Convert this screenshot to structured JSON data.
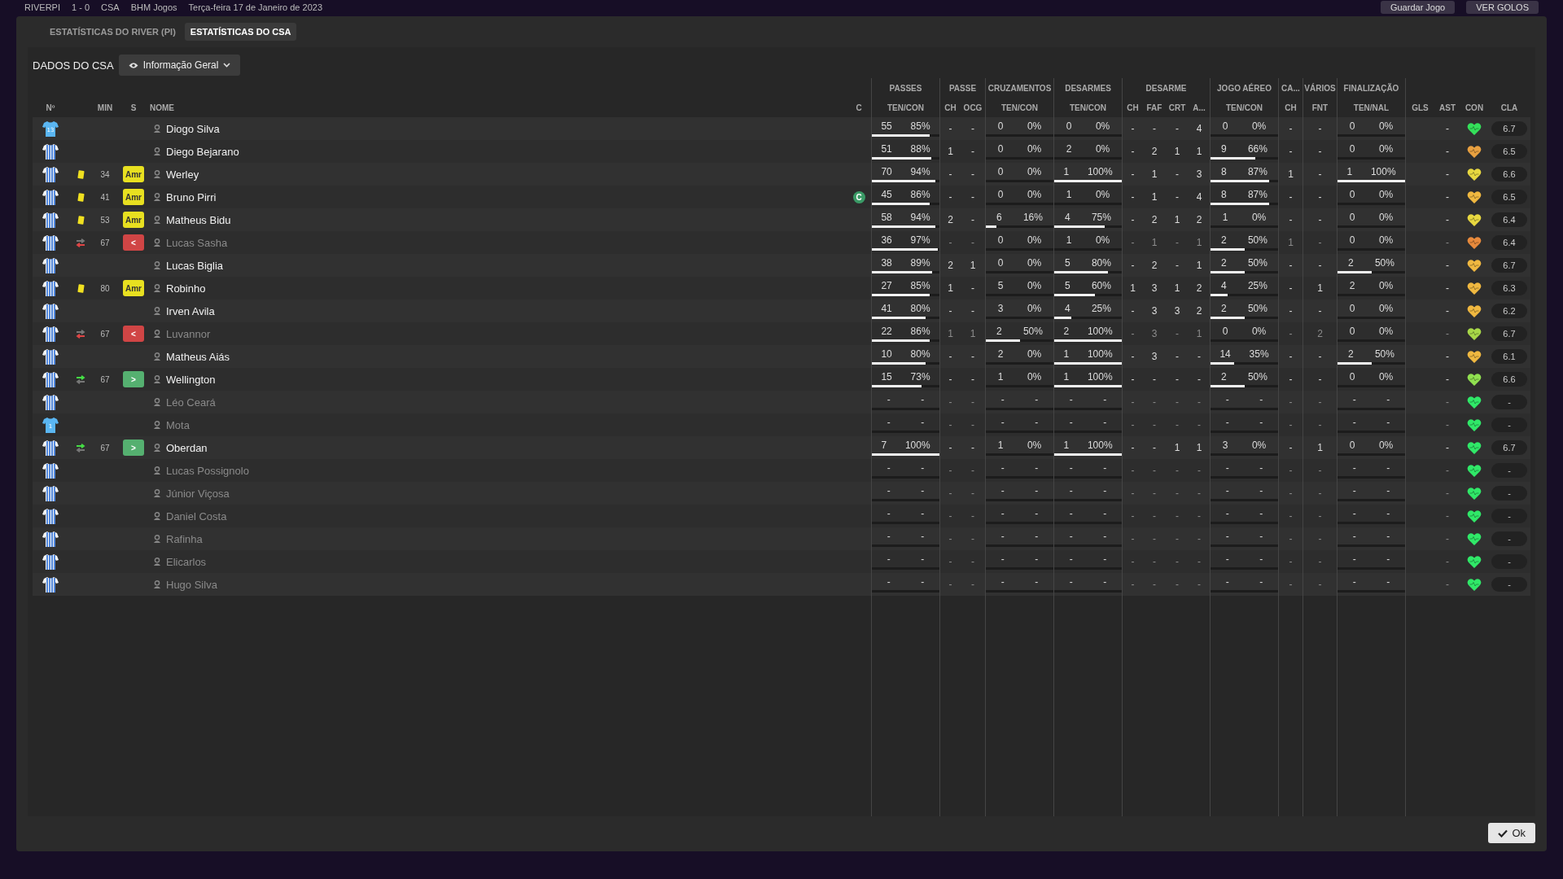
{
  "header": {
    "home": "RIVERPI",
    "score": "1 - 0",
    "away": "CSA",
    "competition": "BHM Jogos",
    "date": "Terça-feira 17 de Janeiro de 2023",
    "save": "Guardar Jogo",
    "goals": "VER GOLOS"
  },
  "tabs": [
    {
      "label": "ESTATÍSTICAS DO RIVER (PI)",
      "selected": false
    },
    {
      "label": "ESTATÍSTICAS DO CSA",
      "selected": true
    }
  ],
  "section_title": "DADOS DO CSA",
  "view_dropdown": {
    "label": "Informação Geral"
  },
  "groups": [
    "PASSES",
    "PASSE",
    "CRUZAMENTOS",
    "DESARMES",
    "DESARME",
    "JOGO AÉREO",
    "CA...",
    "VÁRIOS",
    "FINALIZAÇÃO"
  ],
  "columns": [
    "Nº",
    "MIN",
    "S",
    "NOME",
    "C",
    "TEN/CON",
    "CH",
    "OCG",
    "TEN/CON",
    "TEN/CON",
    "CH",
    "FAF",
    "CRT",
    "A...",
    "TEN/CON",
    "CH",
    "FNT",
    "TEN/NAL",
    "GLS",
    "AST",
    "CON",
    "CLA"
  ],
  "rows": [
    {
      "number": "13",
      "keeper": true,
      "name": "Diogo Silva",
      "dimmed": false,
      "captain": false,
      "passes": {
        "values": [
          "55",
          "85%"
        ],
        "level": 0.85
      },
      "crosses": {
        "values": [
          "0",
          "0%"
        ],
        "level": 0
      },
      "tackles": {
        "values": [
          "0",
          "0%"
        ],
        "level": 0
      },
      "aerial": {
        "values": [
          "0",
          "0%"
        ],
        "level": 0
      },
      "shooting": {
        "values": [
          "0",
          "0%"
        ],
        "level": 0
      },
      "singles": [
        "-",
        "-",
        "-",
        "-",
        "-",
        "4",
        "-",
        "-",
        "-"
      ],
      "color": "#34e05a",
      "rating": "6.7"
    },
    {
      "keeper": false,
      "name": "Diego Bejarano",
      "dimmed": false,
      "captain": false,
      "passes": {
        "values": [
          "51",
          "88%"
        ],
        "level": 0.88
      },
      "crosses": {
        "values": [
          "0",
          "0%"
        ],
        "level": 0
      },
      "tackles": {
        "values": [
          "2",
          "0%"
        ],
        "level": 0
      },
      "aerial": {
        "values": [
          "9",
          "66%"
        ],
        "level": 0.66
      },
      "shooting": {
        "values": [
          "0",
          "0%"
        ],
        "level": 0
      },
      "singles": [
        "1",
        "-",
        "-",
        "2",
        "1",
        "1",
        "-",
        "-",
        "-"
      ],
      "color": "#e8a040",
      "rating": "6.5"
    },
    {
      "keeper": false,
      "event": {
        "kind": "yellow",
        "minute": "34",
        "badge": "Amr"
      },
      "name": "Werley",
      "dimmed": false,
      "captain": false,
      "passes": {
        "values": [
          "70",
          "94%"
        ],
        "level": 0.94
      },
      "crosses": {
        "values": [
          "0",
          "0%"
        ],
        "level": 0
      },
      "tackles": {
        "values": [
          "1",
          "100%"
        ],
        "level": 1
      },
      "aerial": {
        "values": [
          "8",
          "87%"
        ],
        "level": 0.87
      },
      "shooting": {
        "values": [
          "1",
          "100%"
        ],
        "level": 1
      },
      "singles": [
        "-",
        "-",
        "-",
        "1",
        "-",
        "3",
        "1",
        "-",
        "-"
      ],
      "color": "#e8d840",
      "rating": "6.6"
    },
    {
      "keeper": false,
      "event": {
        "kind": "yellow",
        "minute": "41",
        "badge": "Amr"
      },
      "name": "Bruno Pirri",
      "dimmed": false,
      "captain": true,
      "captain_mark": "C",
      "passes": {
        "values": [
          "45",
          "86%"
        ],
        "level": 0.86
      },
      "crosses": {
        "values": [
          "0",
          "0%"
        ],
        "level": 0
      },
      "tackles": {
        "values": [
          "1",
          "0%"
        ],
        "level": 0
      },
      "aerial": {
        "values": [
          "8",
          "87%"
        ],
        "level": 0.87
      },
      "shooting": {
        "values": [
          "0",
          "0%"
        ],
        "level": 0
      },
      "singles": [
        "-",
        "-",
        "-",
        "1",
        "-",
        "4",
        "-",
        "-",
        "-"
      ],
      "color": "#f0b840",
      "rating": "6.5"
    },
    {
      "keeper": false,
      "event": {
        "kind": "yellow",
        "minute": "53",
        "badge": "Amr"
      },
      "name": "Matheus Bidu",
      "dimmed": false,
      "captain": false,
      "passes": {
        "values": [
          "58",
          "94%"
        ],
        "level": 0.94
      },
      "crosses": {
        "values": [
          "6",
          "16%"
        ],
        "level": 0.16
      },
      "tackles": {
        "values": [
          "4",
          "75%"
        ],
        "level": 0.75
      },
      "aerial": {
        "values": [
          "1",
          "0%"
        ],
        "level": 0
      },
      "shooting": {
        "values": [
          "0",
          "0%"
        ],
        "level": 0
      },
      "singles": [
        "2",
        "-",
        "-",
        "2",
        "1",
        "2",
        "-",
        "-",
        "-"
      ],
      "color": "#e8d840",
      "rating": "6.4"
    },
    {
      "keeper": false,
      "event": {
        "kind": "sub_off",
        "minute": "67",
        "badge": "<"
      },
      "name": "Lucas Sasha",
      "dimmed": true,
      "captain": false,
      "passes": {
        "values": [
          "36",
          "97%"
        ],
        "level": 0.97
      },
      "crosses": {
        "values": [
          "0",
          "0%"
        ],
        "level": 0
      },
      "tackles": {
        "values": [
          "1",
          "0%"
        ],
        "level": 0
      },
      "aerial": {
        "values": [
          "2",
          "50%"
        ],
        "level": 0.5
      },
      "shooting": {
        "values": [
          "0",
          "0%"
        ],
        "level": 0
      },
      "singles": [
        "-",
        "-",
        "-",
        "1",
        "-",
        "1",
        "1",
        "-",
        "-"
      ],
      "color": "#e88a3c",
      "rating": "6.4"
    },
    {
      "keeper": false,
      "name": "Lucas Biglia",
      "dimmed": false,
      "captain": false,
      "passes": {
        "values": [
          "38",
          "89%"
        ],
        "level": 0.89
      },
      "crosses": {
        "values": [
          "0",
          "0%"
        ],
        "level": 0
      },
      "tackles": {
        "values": [
          "5",
          "80%"
        ],
        "level": 0.8
      },
      "aerial": {
        "values": [
          "2",
          "50%"
        ],
        "level": 0.5
      },
      "shooting": {
        "values": [
          "2",
          "50%"
        ],
        "level": 0.5
      },
      "singles": [
        "2",
        "1",
        "-",
        "2",
        "-",
        "1",
        "-",
        "-",
        "-"
      ],
      "color": "#f0b840",
      "rating": "6.7"
    },
    {
      "keeper": false,
      "event": {
        "kind": "yellow",
        "minute": "80",
        "badge": "Amr"
      },
      "name": "Robinho",
      "dimmed": false,
      "captain": false,
      "passes": {
        "values": [
          "27",
          "85%"
        ],
        "level": 0.85
      },
      "crosses": {
        "values": [
          "5",
          "0%"
        ],
        "level": 0
      },
      "tackles": {
        "values": [
          "5",
          "60%"
        ],
        "level": 0.6
      },
      "aerial": {
        "values": [
          "4",
          "25%"
        ],
        "level": 0.25
      },
      "shooting": {
        "values": [
          "2",
          "0%"
        ],
        "level": 0
      },
      "singles": [
        "1",
        "-",
        "1",
        "3",
        "1",
        "2",
        "-",
        "1",
        "-"
      ],
      "color": "#f0b840",
      "rating": "6.3"
    },
    {
      "keeper": false,
      "name": "Irven Avila",
      "dimmed": false,
      "captain": false,
      "passes": {
        "values": [
          "41",
          "80%"
        ],
        "level": 0.8
      },
      "crosses": {
        "values": [
          "3",
          "0%"
        ],
        "level": 0
      },
      "tackles": {
        "values": [
          "4",
          "25%"
        ],
        "level": 0.25
      },
      "aerial": {
        "values": [
          "2",
          "50%"
        ],
        "level": 0.5
      },
      "shooting": {
        "values": [
          "0",
          "0%"
        ],
        "level": 0
      },
      "singles": [
        "-",
        "-",
        "-",
        "3",
        "3",
        "2",
        "-",
        "-",
        "-"
      ],
      "color": "#f0b840",
      "rating": "6.2"
    },
    {
      "keeper": false,
      "event": {
        "kind": "sub_off",
        "minute": "67",
        "badge": "<"
      },
      "name": "Luvannor",
      "dimmed": true,
      "captain": false,
      "passes": {
        "values": [
          "22",
          "86%"
        ],
        "level": 0.86
      },
      "crosses": {
        "values": [
          "2",
          "50%"
        ],
        "level": 0.5
      },
      "tackles": {
        "values": [
          "2",
          "100%"
        ],
        "level": 1
      },
      "aerial": {
        "values": [
          "0",
          "0%"
        ],
        "level": 0
      },
      "shooting": {
        "values": [
          "0",
          "0%"
        ],
        "level": 0
      },
      "singles": [
        "1",
        "1",
        "-",
        "3",
        "-",
        "1",
        "-",
        "2",
        "-"
      ],
      "color": "#a8d848",
      "rating": "6.7"
    },
    {
      "keeper": false,
      "name": "Matheus Aiás",
      "dimmed": false,
      "captain": false,
      "passes": {
        "values": [
          "10",
          "80%"
        ],
        "level": 0.8
      },
      "crosses": {
        "values": [
          "2",
          "0%"
        ],
        "level": 0
      },
      "tackles": {
        "values": [
          "1",
          "100%"
        ],
        "level": 1
      },
      "aerial": {
        "values": [
          "14",
          "35%"
        ],
        "level": 0.35
      },
      "shooting": {
        "values": [
          "2",
          "50%"
        ],
        "level": 0.5
      },
      "singles": [
        "-",
        "-",
        "-",
        "3",
        "-",
        "-",
        "-",
        "-",
        "-"
      ],
      "color": "#f0b840",
      "rating": "6.1"
    },
    {
      "keeper": false,
      "event": {
        "kind": "sub_on",
        "minute": "67",
        "badge": ">"
      },
      "name": "Wellington",
      "dimmed": false,
      "captain": false,
      "passes": {
        "values": [
          "15",
          "73%"
        ],
        "level": 0.73
      },
      "crosses": {
        "values": [
          "1",
          "0%"
        ],
        "level": 0
      },
      "tackles": {
        "values": [
          "1",
          "100%"
        ],
        "level": 1
      },
      "aerial": {
        "values": [
          "2",
          "50%"
        ],
        "level": 0.5
      },
      "shooting": {
        "values": [
          "0",
          "0%"
        ],
        "level": 0
      },
      "singles": [
        "-",
        "-",
        "-",
        "-",
        "-",
        "-",
        "-",
        "-",
        "-"
      ],
      "color": "#90e050",
      "rating": "6.6"
    },
    {
      "keeper": false,
      "name": "Léo Ceará",
      "dimmed": true,
      "captain": false,
      "passes": {
        "values": [
          "-",
          "-"
        ],
        "level": 0
      },
      "crosses": {
        "values": [
          "-",
          "-"
        ],
        "level": 0
      },
      "tackles": {
        "values": [
          "-",
          "-"
        ],
        "level": 0
      },
      "aerial": {
        "values": [
          "-",
          "-"
        ],
        "level": 0
      },
      "shooting": {
        "values": [
          "-",
          "-"
        ],
        "level": 0
      },
      "singles": [
        "-",
        "-",
        "-",
        "-",
        "-",
        "-",
        "-",
        "-",
        "-"
      ],
      "color": "#30e868",
      "rating": "-"
    },
    {
      "number": "1",
      "keeper": true,
      "name": "Mota",
      "dimmed": true,
      "captain": false,
      "passes": {
        "values": [
          "-",
          "-"
        ],
        "level": 0
      },
      "crosses": {
        "values": [
          "-",
          "-"
        ],
        "level": 0
      },
      "tackles": {
        "values": [
          "-",
          "-"
        ],
        "level": 0
      },
      "aerial": {
        "values": [
          "-",
          "-"
        ],
        "level": 0
      },
      "shooting": {
        "values": [
          "-",
          "-"
        ],
        "level": 0
      },
      "singles": [
        "-",
        "-",
        "-",
        "-",
        "-",
        "-",
        "-",
        "-",
        "-"
      ],
      "color": "#30e868",
      "rating": "-"
    },
    {
      "keeper": false,
      "event": {
        "kind": "sub_on",
        "minute": "67",
        "badge": ">"
      },
      "name": "Oberdan",
      "dimmed": false,
      "captain": false,
      "passes": {
        "values": [
          "7",
          "100%"
        ],
        "level": 1
      },
      "crosses": {
        "values": [
          "1",
          "0%"
        ],
        "level": 0
      },
      "tackles": {
        "values": [
          "1",
          "100%"
        ],
        "level": 1
      },
      "aerial": {
        "values": [
          "3",
          "0%"
        ],
        "level": 0
      },
      "shooting": {
        "values": [
          "0",
          "0%"
        ],
        "level": 0
      },
      "singles": [
        "-",
        "-",
        "-",
        "-",
        "1",
        "1",
        "-",
        "1",
        "-"
      ],
      "color": "#30e868",
      "rating": "6.7"
    },
    {
      "keeper": false,
      "name": "Lucas Possignolo",
      "dimmed": true,
      "captain": false,
      "passes": {
        "values": [
          "-",
          "-"
        ],
        "level": 0
      },
      "crosses": {
        "values": [
          "-",
          "-"
        ],
        "level": 0
      },
      "tackles": {
        "values": [
          "-",
          "-"
        ],
        "level": 0
      },
      "aerial": {
        "values": [
          "-",
          "-"
        ],
        "level": 0
      },
      "shooting": {
        "values": [
          "-",
          "-"
        ],
        "level": 0
      },
      "singles": [
        "-",
        "-",
        "-",
        "-",
        "-",
        "-",
        "-",
        "-",
        "-"
      ],
      "color": "#30e868",
      "rating": "-"
    },
    {
      "keeper": false,
      "name": "Júnior Viçosa",
      "dimmed": true,
      "captain": false,
      "passes": {
        "values": [
          "-",
          "-"
        ],
        "level": 0
      },
      "crosses": {
        "values": [
          "-",
          "-"
        ],
        "level": 0
      },
      "tackles": {
        "values": [
          "-",
          "-"
        ],
        "level": 0
      },
      "aerial": {
        "values": [
          "-",
          "-"
        ],
        "level": 0
      },
      "shooting": {
        "values": [
          "-",
          "-"
        ],
        "level": 0
      },
      "singles": [
        "-",
        "-",
        "-",
        "-",
        "-",
        "-",
        "-",
        "-",
        "-"
      ],
      "color": "#30e868",
      "rating": "-"
    },
    {
      "keeper": false,
      "name": "Daniel Costa",
      "dimmed": true,
      "captain": false,
      "passes": {
        "values": [
          "-",
          "-"
        ],
        "level": 0
      },
      "crosses": {
        "values": [
          "-",
          "-"
        ],
        "level": 0
      },
      "tackles": {
        "values": [
          "-",
          "-"
        ],
        "level": 0
      },
      "aerial": {
        "values": [
          "-",
          "-"
        ],
        "level": 0
      },
      "shooting": {
        "values": [
          "-",
          "-"
        ],
        "level": 0
      },
      "singles": [
        "-",
        "-",
        "-",
        "-",
        "-",
        "-",
        "-",
        "-",
        "-"
      ],
      "color": "#30e868",
      "rating": "-"
    },
    {
      "keeper": false,
      "name": "Rafinha",
      "dimmed": true,
      "captain": false,
      "passes": {
        "values": [
          "-",
          "-"
        ],
        "level": 0
      },
      "crosses": {
        "values": [
          "-",
          "-"
        ],
        "level": 0
      },
      "tackles": {
        "values": [
          "-",
          "-"
        ],
        "level": 0
      },
      "aerial": {
        "values": [
          "-",
          "-"
        ],
        "level": 0
      },
      "shooting": {
        "values": [
          "-",
          "-"
        ],
        "level": 0
      },
      "singles": [
        "-",
        "-",
        "-",
        "-",
        "-",
        "-",
        "-",
        "-",
        "-"
      ],
      "color": "#30e868",
      "rating": "-"
    },
    {
      "keeper": false,
      "name": "Elicarlos",
      "dimmed": true,
      "captain": false,
      "passes": {
        "values": [
          "-",
          "-"
        ],
        "level": 0
      },
      "crosses": {
        "values": [
          "-",
          "-"
        ],
        "level": 0
      },
      "tackles": {
        "values": [
          "-",
          "-"
        ],
        "level": 0
      },
      "aerial": {
        "values": [
          "-",
          "-"
        ],
        "level": 0
      },
      "shooting": {
        "values": [
          "-",
          "-"
        ],
        "level": 0
      },
      "singles": [
        "-",
        "-",
        "-",
        "-",
        "-",
        "-",
        "-",
        "-",
        "-"
      ],
      "color": "#30e868",
      "rating": "-"
    },
    {
      "keeper": false,
      "name": "Hugo Silva",
      "dimmed": true,
      "captain": false,
      "passes": {
        "values": [
          "-",
          "-"
        ],
        "level": 0
      },
      "crosses": {
        "values": [
          "-",
          "-"
        ],
        "level": 0
      },
      "tackles": {
        "values": [
          "-",
          "-"
        ],
        "level": 0
      },
      "aerial": {
        "values": [
          "-",
          "-"
        ],
        "level": 0
      },
      "shooting": {
        "values": [
          "-",
          "-"
        ],
        "level": 0
      },
      "singles": [
        "-",
        "-",
        "-",
        "-",
        "-",
        "-",
        "-",
        "-",
        "-"
      ],
      "color": "#30e868",
      "rating": "-"
    }
  ],
  "ok_button": "Ok"
}
